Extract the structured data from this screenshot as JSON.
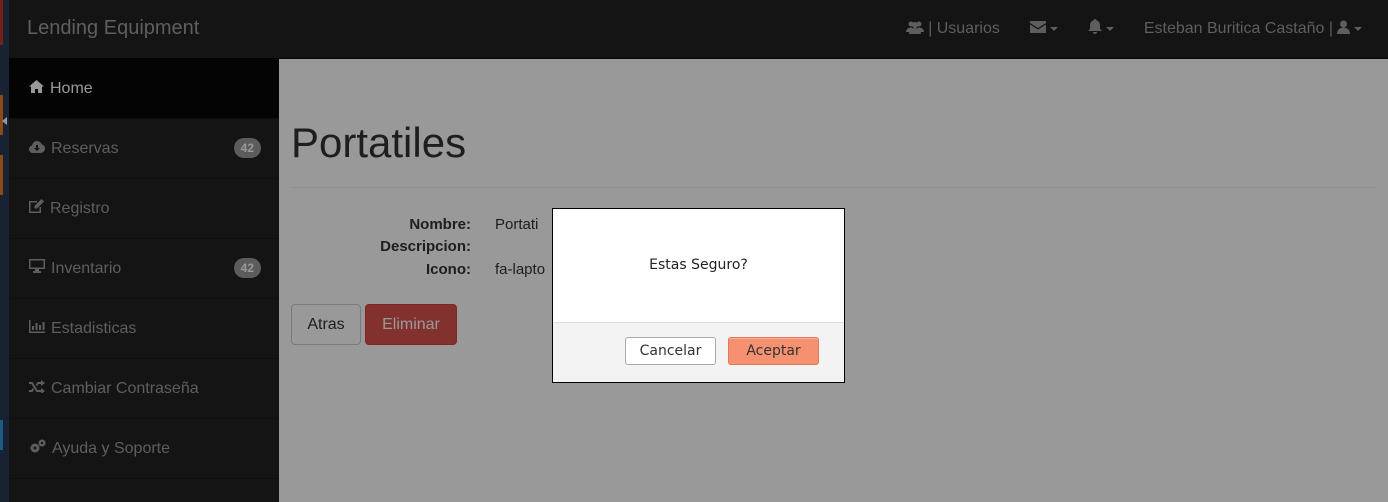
{
  "navbar": {
    "brand": "Lending Equipment",
    "users_label": "| Usuarios",
    "user_name": "Esteban Buritica Castaño |"
  },
  "sidebar": {
    "items": [
      {
        "label": "Home",
        "icon": "home-icon",
        "active": true
      },
      {
        "label": "Reservas",
        "icon": "cloud-download-icon",
        "badge": "42"
      },
      {
        "label": "Registro",
        "icon": "edit-icon"
      },
      {
        "label": "Inventario",
        "icon": "desktop-icon",
        "badge": "42"
      },
      {
        "label": "Estadisticas",
        "icon": "bar-chart-icon"
      },
      {
        "label": "Cambiar Contraseña",
        "icon": "random-icon"
      },
      {
        "label": "Ayuda y Soporte",
        "icon": "cogs-icon"
      }
    ]
  },
  "page": {
    "title": "Portatiles",
    "fields": [
      {
        "label": "Nombre:",
        "value": "Portati"
      },
      {
        "label": "Descripcion:",
        "value": ""
      },
      {
        "label": "Icono:",
        "value": "fa-lapto"
      }
    ],
    "back_button": "Atras",
    "delete_button": "Eliminar"
  },
  "modal": {
    "message": "Estas Seguro?",
    "cancel_label": "Cancelar",
    "accept_label": "Aceptar"
  },
  "colors": {
    "navbar_bg": "#222222",
    "danger": "#d9534f",
    "accept": "#f59070"
  }
}
